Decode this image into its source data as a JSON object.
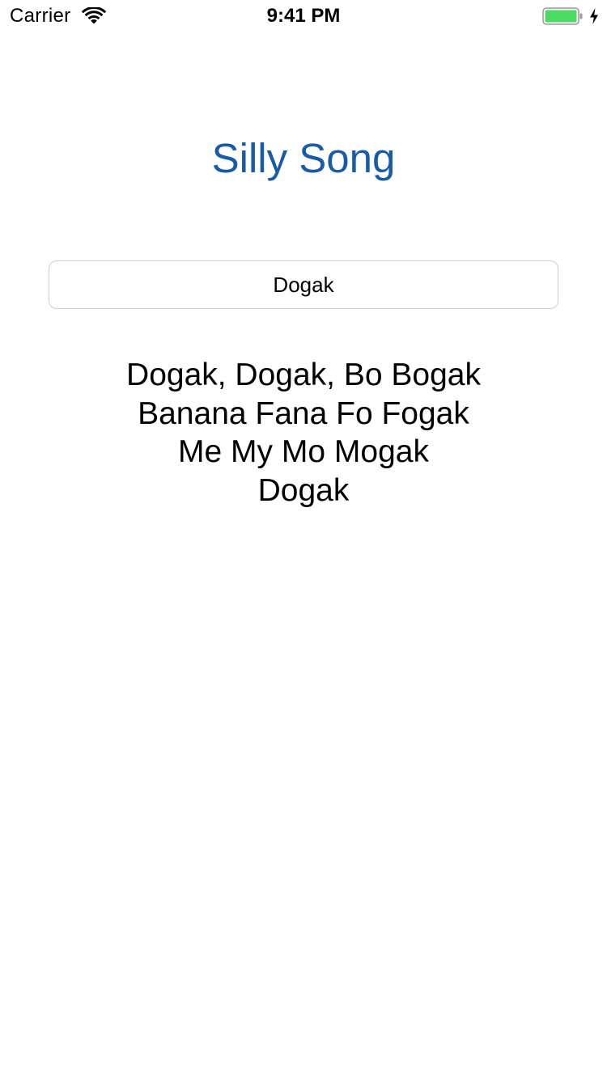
{
  "status_bar": {
    "carrier": "Carrier",
    "time": "9:41 PM",
    "icons": [
      "wifi-icon",
      "battery-icon",
      "charging-bolt-icon"
    ],
    "battery_color": "#4cd964"
  },
  "app": {
    "title": "Silly Song",
    "title_color": "#1a5ba6",
    "name_field": {
      "value": "Dogak",
      "placeholder": ""
    },
    "lyrics": [
      "Dogak, Dogak, Bo Bogak",
      "Banana Fana Fo Fogak",
      "Me My Mo Mogak",
      "Dogak"
    ]
  }
}
